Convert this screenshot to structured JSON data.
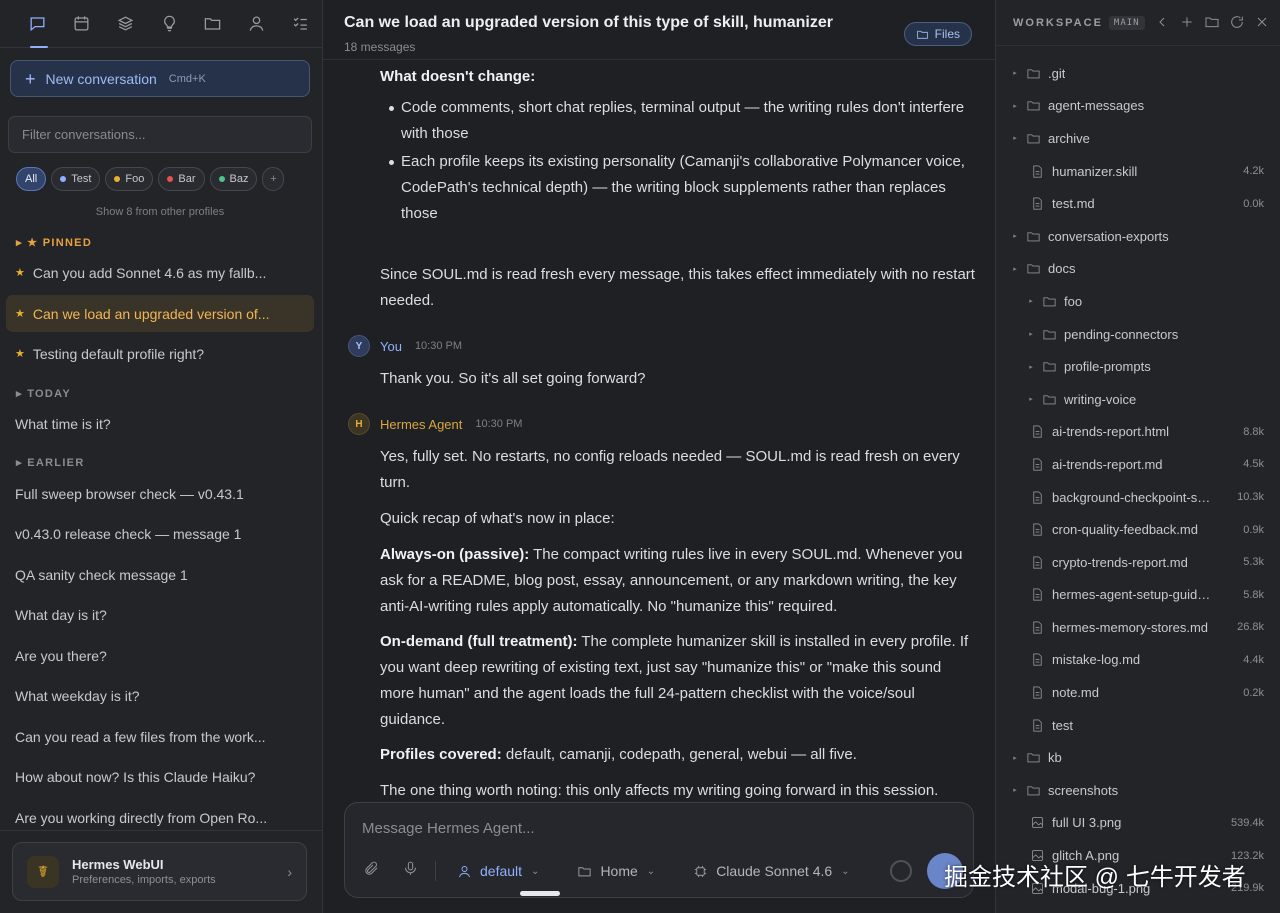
{
  "sidebar": {
    "top_icons": [
      "chat-icon",
      "calendar-icon",
      "layers-icon",
      "lightbulb-icon",
      "folder-icon",
      "user-icon",
      "checklist-icon"
    ],
    "new_conversation": {
      "label": "New conversation",
      "shortcut": "Cmd+K"
    },
    "filter_placeholder": "Filter conversations...",
    "chips": [
      {
        "label": "All",
        "color": ""
      },
      {
        "label": "Test",
        "color": "#8fb0ff"
      },
      {
        "label": "Foo",
        "color": "#e8b030"
      },
      {
        "label": "Bar",
        "color": "#e5534b"
      },
      {
        "label": "Baz",
        "color": "#4cc38a"
      },
      {
        "label": "+",
        "color": ""
      }
    ],
    "show_more": "Show 8 from other profiles",
    "pinned_label": "PINNED",
    "pinned": [
      "Can you add Sonnet 4.6 as my fallb...",
      "Can we load an upgraded version of...",
      "Testing default profile right?"
    ],
    "today_label": "TODAY",
    "today": [
      "What time is it?"
    ],
    "earlier_label": "EARLIER",
    "earlier": [
      "Full sweep browser check — v0.43.1",
      "v0.43.0 release check — message 1",
      "QA sanity check message 1",
      "What day is it?",
      "Are you there?",
      "What weekday is it?",
      "Can you read a few files from the work...",
      "How about now? Is this Claude Haiku?",
      "Are you working directly from Open Ro..."
    ],
    "profile_card": {
      "title": "Hermes WebUI",
      "subtitle": "Preferences, imports, exports"
    }
  },
  "main": {
    "title": "Can we load an upgraded version of this type of skill, humanizer",
    "message_count": "18 messages",
    "files_button": "Files",
    "m1": {
      "heading": "What doesn't change:",
      "bullet1": "Code comments, short chat replies, terminal output — the writing rules don't interfere with those",
      "bullet2": "Each profile keeps its existing personality (Camanji's collaborative Polymancer voice, CodePath's technical depth) — the writing block supplements rather than replaces those",
      "tail": "Since SOUL.md is read fresh every message, this takes effect immediately with no restart needed."
    },
    "you": {
      "avatar": "Y",
      "name": "You",
      "time": "10:30 PM",
      "text": "Thank you. So it's all set going forward?"
    },
    "agent": {
      "avatar": "H",
      "name": "Hermes Agent",
      "time": "10:30 PM",
      "p1": "Yes, fully set. No restarts, no config reloads needed — SOUL.md is read fresh on every turn.",
      "p2": "Quick recap of what's now in place:",
      "p3_bold": "Always-on (passive):",
      "p3": " The compact writing rules live in every SOUL.md. Whenever you ask for a README, blog post, essay, announcement, or any markdown writing, the key anti-AI-writing rules apply automatically. No \"humanize this\" required.",
      "p4_bold": "On-demand (full treatment):",
      "p4": " The complete humanizer skill is installed in every profile. If you want deep rewriting of existing text, just say \"humanize this\" or \"make this sound more human\" and the agent loads the full 24-pattern checklist with the voice/soul guidance.",
      "p5_bold": "Profiles covered:",
      "p5": " default, camanji, codepath, general, webui — all five.",
      "p6": "The one thing worth noting: this only affects my writing going forward in this session."
    },
    "composer": {
      "placeholder": "Message Hermes Agent...",
      "profile": "default",
      "workspace": "Home",
      "model": "Claude Sonnet 4.6"
    }
  },
  "workspace": {
    "title": "WORKSPACE",
    "branch": "MAIN",
    "tree": [
      {
        "name": ".git",
        "type": "folder",
        "depth": 0,
        "size": ""
      },
      {
        "name": "agent-messages",
        "type": "folder",
        "depth": 0,
        "size": ""
      },
      {
        "name": "archive",
        "type": "folder-open",
        "depth": 0,
        "size": ""
      },
      {
        "name": "humanizer.skill",
        "type": "file",
        "depth": 1,
        "size": "4.2k"
      },
      {
        "name": "test.md",
        "type": "file",
        "depth": 1,
        "size": "0.0k"
      },
      {
        "name": "conversation-exports",
        "type": "folder",
        "depth": 0,
        "size": ""
      },
      {
        "name": "docs",
        "type": "folder-open",
        "depth": 0,
        "size": ""
      },
      {
        "name": "foo",
        "type": "folder",
        "depth": 1,
        "size": ""
      },
      {
        "name": "pending-connectors",
        "type": "folder",
        "depth": 1,
        "size": ""
      },
      {
        "name": "profile-prompts",
        "type": "folder",
        "depth": 1,
        "size": ""
      },
      {
        "name": "writing-voice",
        "type": "folder",
        "depth": 1,
        "size": ""
      },
      {
        "name": "ai-trends-report.html",
        "type": "file",
        "depth": 1,
        "size": "8.8k"
      },
      {
        "name": "ai-trends-report.md",
        "type": "file",
        "depth": 1,
        "size": "4.5k"
      },
      {
        "name": "background-checkpoint-sy...",
        "type": "file",
        "depth": 1,
        "size": "10.3k"
      },
      {
        "name": "cron-quality-feedback.md",
        "type": "file",
        "depth": 1,
        "size": "0.9k"
      },
      {
        "name": "crypto-trends-report.md",
        "type": "file",
        "depth": 1,
        "size": "5.3k"
      },
      {
        "name": "hermes-agent-setup-guide....",
        "type": "file",
        "depth": 1,
        "size": "5.8k"
      },
      {
        "name": "hermes-memory-stores.md",
        "type": "file",
        "depth": 1,
        "size": "26.8k"
      },
      {
        "name": "mistake-log.md",
        "type": "file",
        "depth": 1,
        "size": "4.4k"
      },
      {
        "name": "note.md",
        "type": "file",
        "depth": 1,
        "size": "0.2k"
      },
      {
        "name": "test",
        "type": "file",
        "depth": 1,
        "size": ""
      },
      {
        "name": "kb",
        "type": "folder",
        "depth": 0,
        "size": ""
      },
      {
        "name": "screenshots",
        "type": "folder-open",
        "depth": 0,
        "size": ""
      },
      {
        "name": "full UI 3.png",
        "type": "image",
        "depth": 1,
        "size": "539.4k"
      },
      {
        "name": "glitch A.png",
        "type": "image",
        "depth": 1,
        "size": "123.2k"
      },
      {
        "name": "modal-bug-1.png",
        "type": "image",
        "depth": 1,
        "size": "219.9k"
      }
    ]
  },
  "watermark": "掘金技术社区 @ 七牛开发者"
}
